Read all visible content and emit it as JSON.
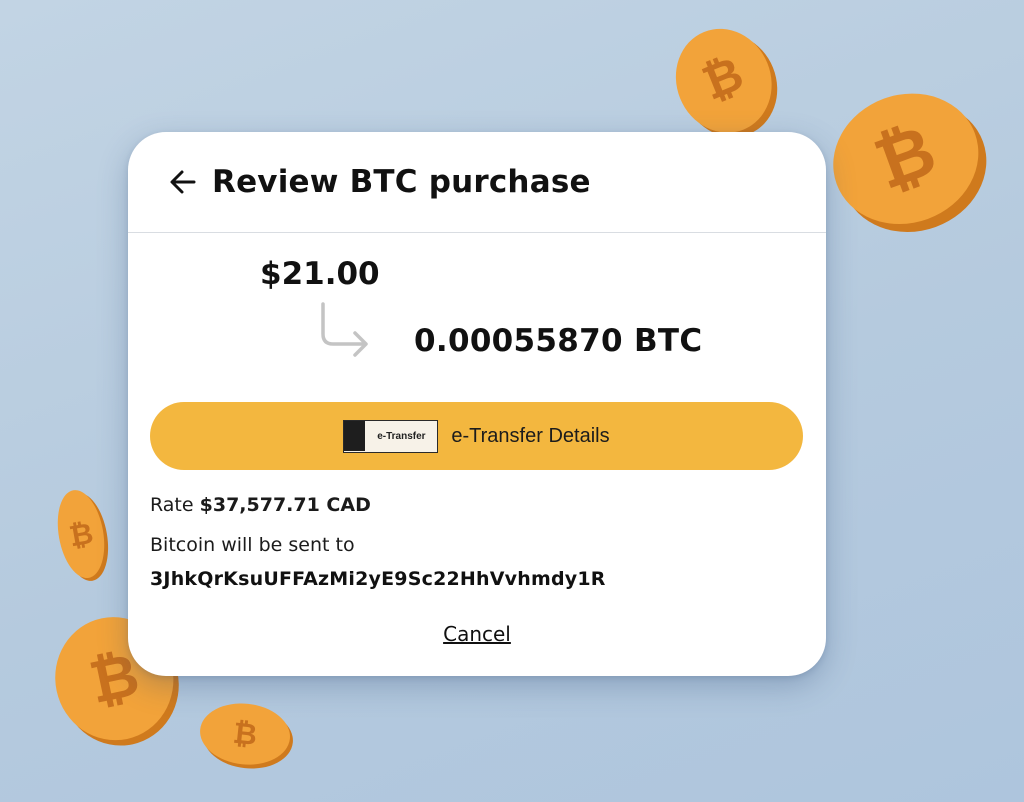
{
  "header": {
    "title": "Review BTC purchase",
    "back_icon": "arrow-left-icon"
  },
  "conversion": {
    "from_amount": "$21.00",
    "arrow_icon": "arrow-down-right-icon",
    "to_amount": "0.00055870 BTC"
  },
  "etransfer": {
    "logo_mark": "Interac",
    "logo_text": "e-Transfer",
    "button_label": "e-Transfer Details"
  },
  "details": {
    "rate_label": "Rate",
    "rate_value": "$37,577.71 CAD",
    "send_to_label": "Bitcoin will be sent to",
    "address": "3JhkQrKsuUFFAzMi2yE9Sc22HhVvhmdy1R"
  },
  "actions": {
    "cancel_label": "Cancel"
  },
  "colors": {
    "accent": "#f3b73f",
    "coin_face": "#f2a33a",
    "coin_edge": "#cf7a1d",
    "coin_symbol": "#c8711e",
    "background": "#b8cce0"
  },
  "decorations": {
    "coin_icon": "bitcoin-coin-icon"
  }
}
